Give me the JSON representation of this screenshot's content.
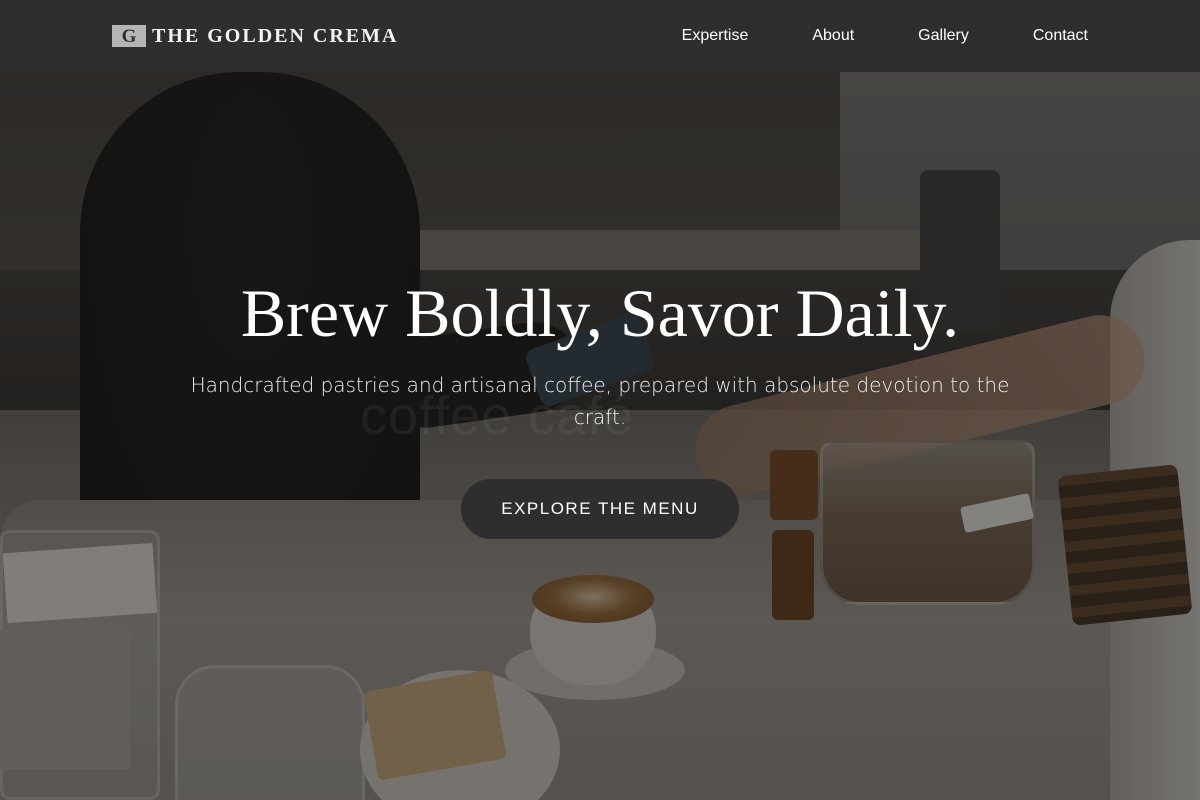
{
  "header": {
    "brand_mark": "G",
    "brand_name": "THE GOLDEN CREMA",
    "nav": [
      {
        "label": "Expertise"
      },
      {
        "label": "About"
      },
      {
        "label": "Gallery"
      },
      {
        "label": "Contact"
      }
    ]
  },
  "hero": {
    "title": "Brew Boldly, Savor Daily.",
    "subtitle": "Handcrafted pastries and artisanal coffee, prepared with absolute devotion to the craft.",
    "cta_label": "EXPLORE THE MENU",
    "watermark": "coffee café"
  },
  "colors": {
    "navbar_bg": "#2e2e2e",
    "button_bg": "#2f2d2d",
    "text": "#ffffff"
  }
}
